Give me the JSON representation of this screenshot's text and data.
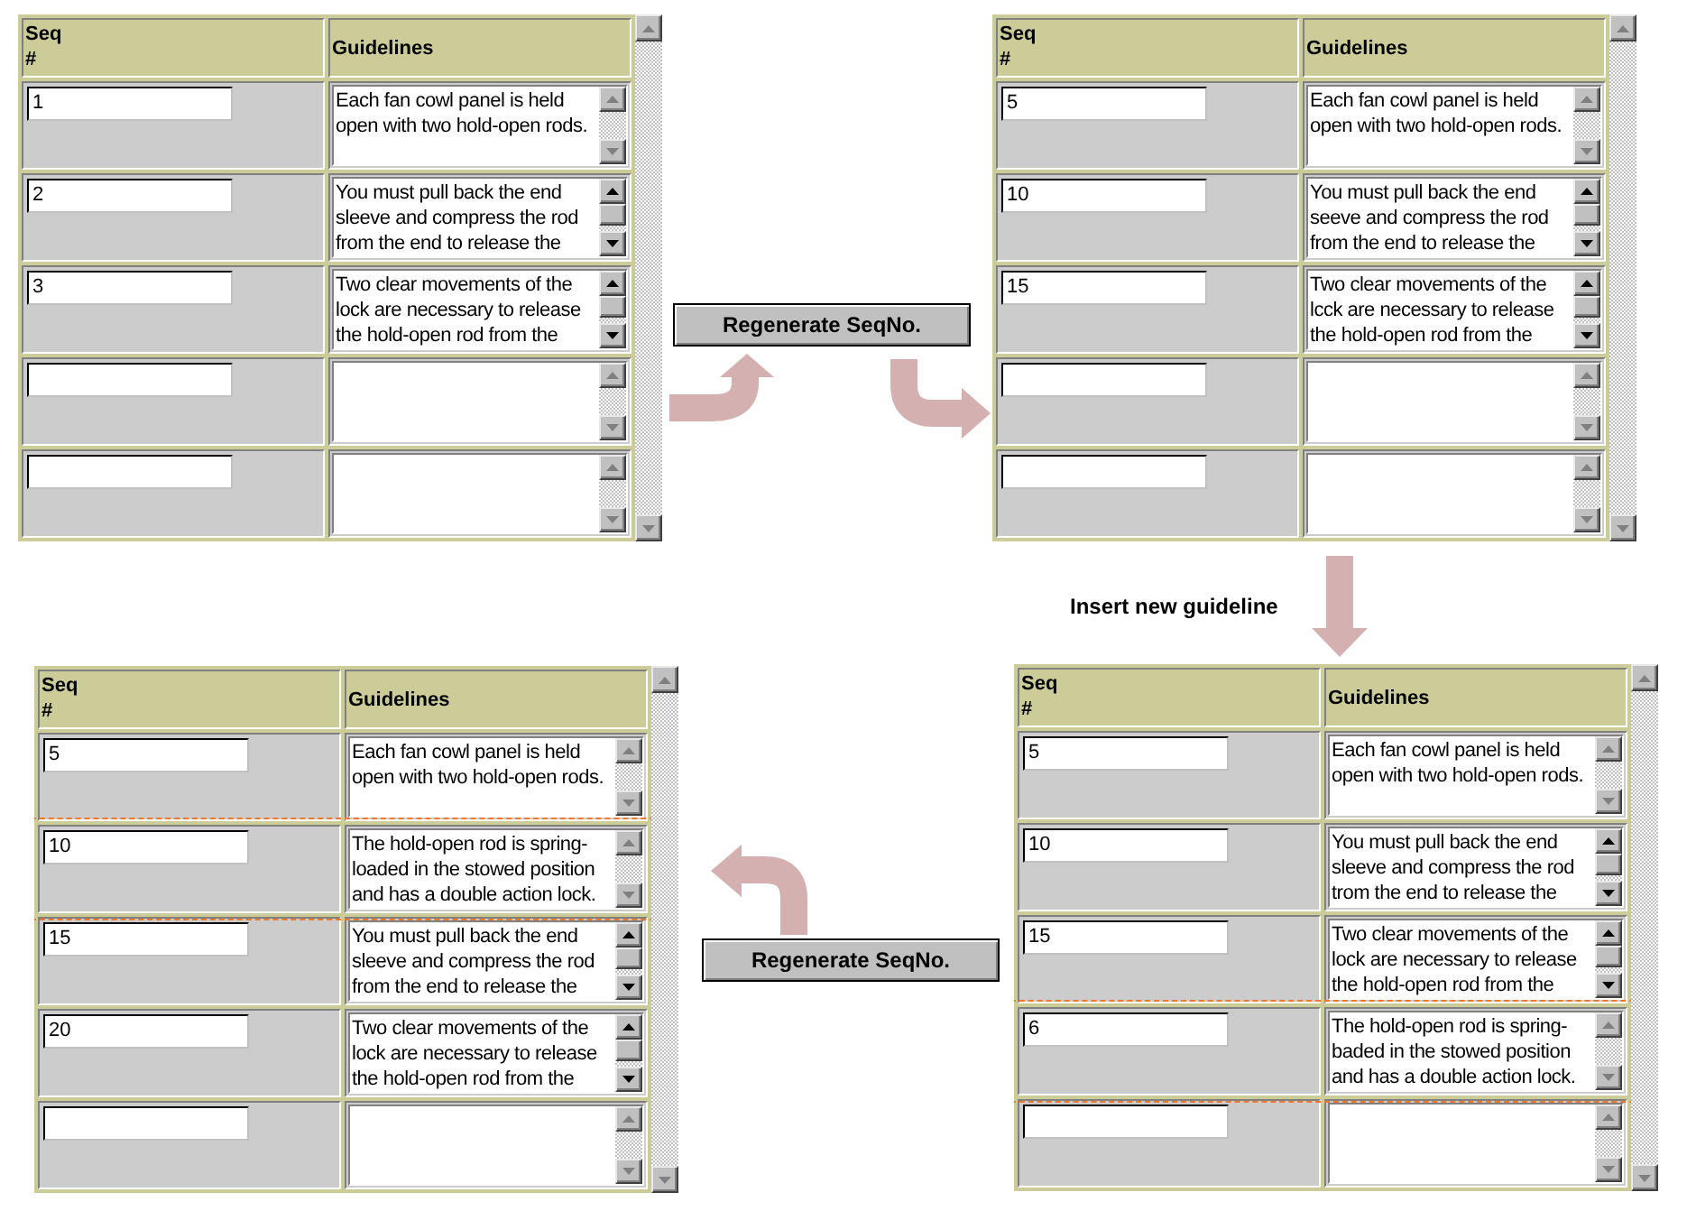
{
  "panels": [
    {
      "columns": [
        "Seq #",
        "Guidelines"
      ],
      "rows": [
        {
          "seq": "1",
          "guideline": "Each fan cowl panel is held open with two hold-open rods.",
          "scrollable": false,
          "highlighted": false
        },
        {
          "seq": "2",
          "guideline": "You must pull back the end sleeve and compress the rod from the end to release the",
          "scrollable": true,
          "highlighted": false
        },
        {
          "seq": "3",
          "guideline": "Two clear movements of the lock are necessary to release the hold-open rod from the",
          "scrollable": true,
          "highlighted": false
        },
        {
          "scrollable": false,
          "highlighted": false
        },
        {
          "scrollable": false,
          "highlighted": false
        }
      ]
    },
    {
      "columns": [
        "Seq #",
        "Guidelines"
      ],
      "rows": [
        {
          "seq": "5",
          "guideline": "Each fan cowl panel is held open with two hold-open rods.",
          "scrollable": false,
          "highlighted": false
        },
        {
          "seq": "10",
          "guideline": "You must pull back the end seeve and compress the rod from the end to release the",
          "scrollable": true,
          "highlighted": false
        },
        {
          "seq": "15",
          "guideline": "Two clear movements of the lcck are necessary to release the hold-open rod from the",
          "scrollable": true,
          "highlighted": false
        },
        {
          "scrollable": false,
          "highlighted": false
        },
        {
          "scrollable": false,
          "highlighted": false
        }
      ]
    },
    {
      "columns": [
        "Seq #",
        "Guidelines"
      ],
      "rows": [
        {
          "seq": "5",
          "guideline": "Each fan cowl panel is held open with two hold-open rods.",
          "scrollable": false,
          "highlighted": false
        },
        {
          "seq": "10",
          "guideline": "The hold-open rod is spring-loaded in the stowed position and has a double action lock.",
          "scrollable": false,
          "highlighted": true
        },
        {
          "seq": "15",
          "guideline": "You must pull back the end sleeve and compress the rod from the end to release the",
          "scrollable": true,
          "highlighted": false
        },
        {
          "seq": "20",
          "guideline": "Two clear movements of the lock are necessary to release the hold-open rod from the",
          "scrollable": true,
          "highlighted": false
        },
        {
          "scrollable": false,
          "highlighted": false
        }
      ]
    },
    {
      "columns": [
        "Seq #",
        "Guidelines"
      ],
      "rows": [
        {
          "seq": "5",
          "guideline": "Each fan cowl panel is held open with two hold-open rods.",
          "scrollable": false,
          "highlighted": false
        },
        {
          "seq": "10",
          "guideline": "You must pull back the end sleeve and compress the rod trom the end to release the",
          "scrollable": true,
          "highlighted": false
        },
        {
          "seq": "15",
          "guideline": "Two clear movements of the lock are necessary to release the hold-open rod from the",
          "scrollable": true,
          "highlighted": false
        },
        {
          "seq": "6",
          "guideline": "The hold-open rod is spring-baded in the stowed position and has a double action lock.",
          "scrollable": false,
          "highlighted": true
        },
        {
          "scrollable": false,
          "highlighted": false
        }
      ]
    }
  ],
  "buttons": [
    {
      "label": "Regenerate SeqNo."
    },
    {
      "label": "Regenerate SeqNo."
    }
  ],
  "caption": "Insert new guideline"
}
